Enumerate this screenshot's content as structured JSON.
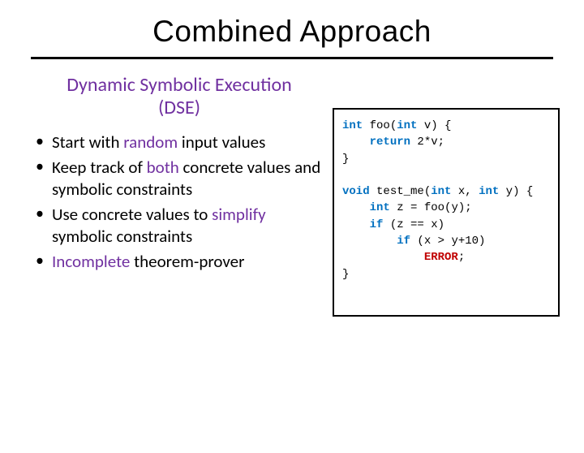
{
  "title": "Combined Approach",
  "subheading_line1": "Dynamic Symbolic Execution",
  "subheading_line2": "(DSE)",
  "bullets": [
    {
      "pre": "Start with ",
      "accent": "random",
      "post": " input values"
    },
    {
      "pre": "Keep track of ",
      "accent": "both",
      "post": " concrete values and symbolic constraints"
    },
    {
      "pre": "Use concrete values to ",
      "accent": "simplify",
      "post": " symbolic constraints"
    },
    {
      "pre": "",
      "accent": "Incomplete",
      "post": " theorem-prover"
    }
  ],
  "code": {
    "kw_int": "int",
    "kw_void": "void",
    "kw_return": "return",
    "kw_if": "if",
    "err": "ERROR",
    "foo_sig_open": " foo(",
    "foo_param": " v) {",
    "foo_body_ret": " 2*v;",
    "close_brace": "}",
    "blank": "",
    "test_sig_open": " test_me(",
    "test_param_x": " x, ",
    "test_param_y": " y) {",
    "decl_z_pre": " z = foo(y);",
    "if1": " (z == x)",
    "if2": " (x > y+10)",
    "err_suffix": ";"
  }
}
